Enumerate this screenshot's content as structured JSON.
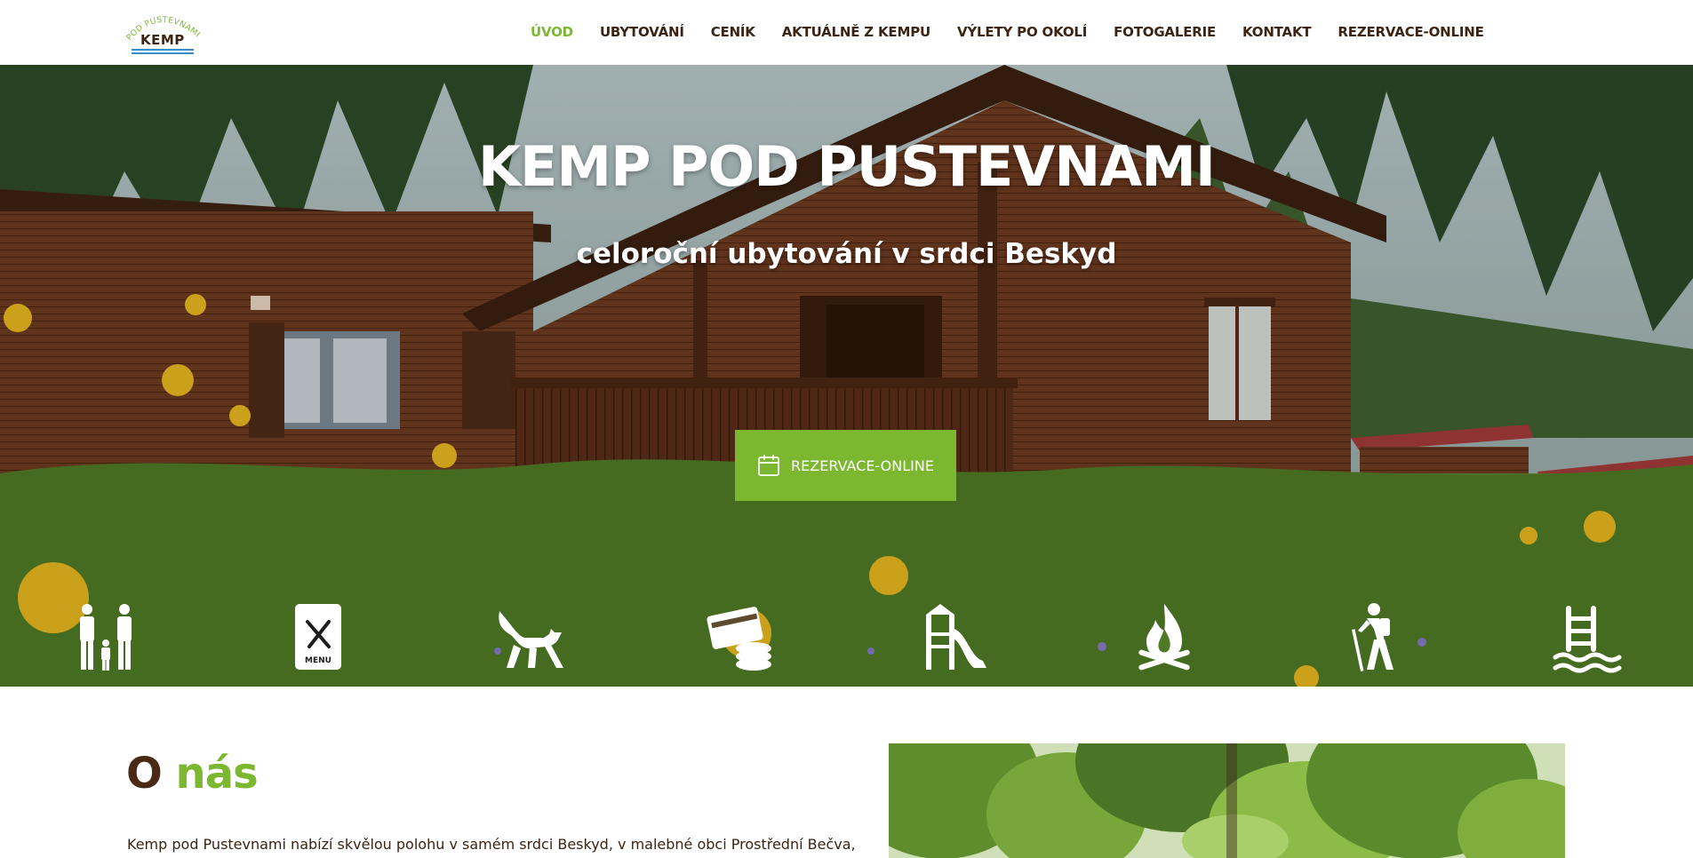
{
  "brand": {
    "logo_arc_text": "POD PUSTEVNAMI",
    "logo_word": "KEMP"
  },
  "nav": {
    "items": [
      {
        "label": "ÚVOD",
        "active": true
      },
      {
        "label": "UBYTOVÁNÍ",
        "active": false
      },
      {
        "label": "CENÍK",
        "active": false
      },
      {
        "label": "AKTUÁLNĚ Z KEMPU",
        "active": false
      },
      {
        "label": "VÝLETY PO OKOLÍ",
        "active": false
      },
      {
        "label": "FOTOGALERIE",
        "active": false
      },
      {
        "label": "KONTAKT",
        "active": false
      },
      {
        "label": "REZERVACE-ONLINE",
        "active": false
      }
    ]
  },
  "hero": {
    "title": "KEMP POD PUSTEVNAMI",
    "subtitle": "celoroční ubytování v srdci Beskyd",
    "cta_label": "REZERVACE-ONLINE",
    "amenities": [
      {
        "icon": "family-icon"
      },
      {
        "icon": "restaurant-menu-icon",
        "text": "MENU"
      },
      {
        "icon": "pets-cat-icon"
      },
      {
        "icon": "card-payment-icon"
      },
      {
        "icon": "playground-slide-icon"
      },
      {
        "icon": "campfire-icon"
      },
      {
        "icon": "hiking-icon"
      },
      {
        "icon": "swimming-pool-icon"
      }
    ]
  },
  "about": {
    "title_first": "O",
    "title_second": "nás",
    "text": "Kemp pod Pustevnami nabízí skvělou polohu v samém srdci Beskyd, v malebné obci Prostřední Bečva,"
  },
  "colors": {
    "accent_green": "#7cb82f",
    "brown_text": "#3b2413",
    "logo_lines": "#3a8dc8"
  }
}
